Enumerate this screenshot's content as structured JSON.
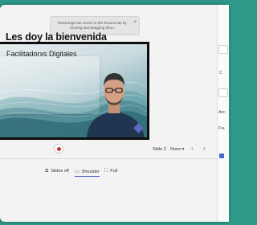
{
  "toast": {
    "message": "Rearrange the rooms in the Rooms tab by clicking and dragging them.",
    "close_icon": "×"
  },
  "slide": {
    "title": "Les doy la bienvenida",
    "subtitle": "Facilitadorxs Digitales"
  },
  "controls": {
    "record_icon": "record-icon",
    "slide_indicator": "Slide 2",
    "notes_selector": "None ▾",
    "prev_icon": "‹",
    "next_icon": "›"
  },
  "layout_tabs": [
    {
      "label": "Slides off",
      "icon": "⧉"
    },
    {
      "label": "Shoulder",
      "icon": "▭"
    },
    {
      "label": "Full",
      "icon": "⛶"
    }
  ],
  "right_panel": {
    "label_1": "C",
    "label_2": "Anc",
    "label_3": "Fra"
  },
  "colors": {
    "accent": "#4a63c8",
    "record": "#d42f2f",
    "background": "#2f9a8a"
  }
}
